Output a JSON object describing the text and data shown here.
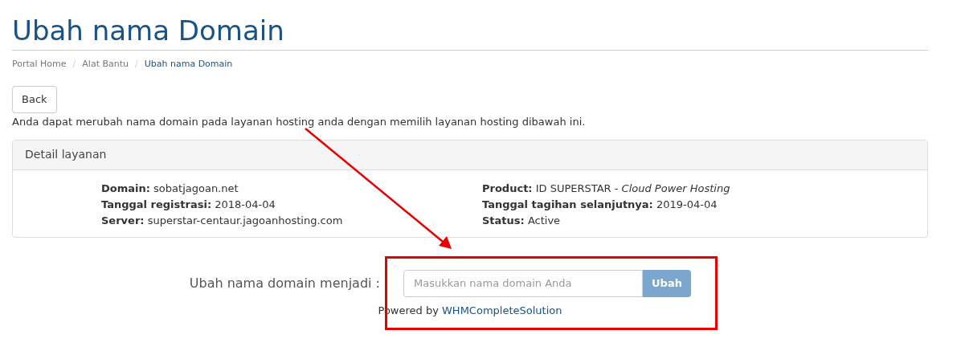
{
  "page_title": "Ubah nama Domain",
  "breadcrumb": [
    {
      "label": "Portal Home",
      "selected": false
    },
    {
      "label": "Alat Bantu",
      "selected": false
    },
    {
      "label": "Ubah nama Domain",
      "selected": true
    }
  ],
  "breadcrumb_separator": "/",
  "back_button": "Back",
  "intro": "Anda dapat merubah nama domain pada layanan hosting anda dengan memilih layanan hosting dibawah ini.",
  "panel": {
    "title": "Detail layanan",
    "columns": [
      [
        {
          "label": "Domain:",
          "value": "sobatjagoan.net"
        },
        {
          "label": "Tanggal registrasi:",
          "value": "2018-04-04"
        },
        {
          "label": "Server:",
          "value": "superstar-centaur.jagoanhosting.com"
        }
      ],
      [
        {
          "label": "Product:",
          "value": "ID SUPERSTAR - *Cloud Power Hosting*"
        },
        {
          "label": "Tanggal tagihan selanjutnya:",
          "value": "2019-04-04"
        },
        {
          "label": "Status:",
          "value": "Active"
        }
      ]
    ]
  },
  "form": {
    "label": "Ubah nama domain menjadi :",
    "placeholder": "Masukkan nama domain Anda",
    "button": "Ubah"
  },
  "footer": {
    "text": "Powered by",
    "link": "WHMCompleteSolution"
  }
}
